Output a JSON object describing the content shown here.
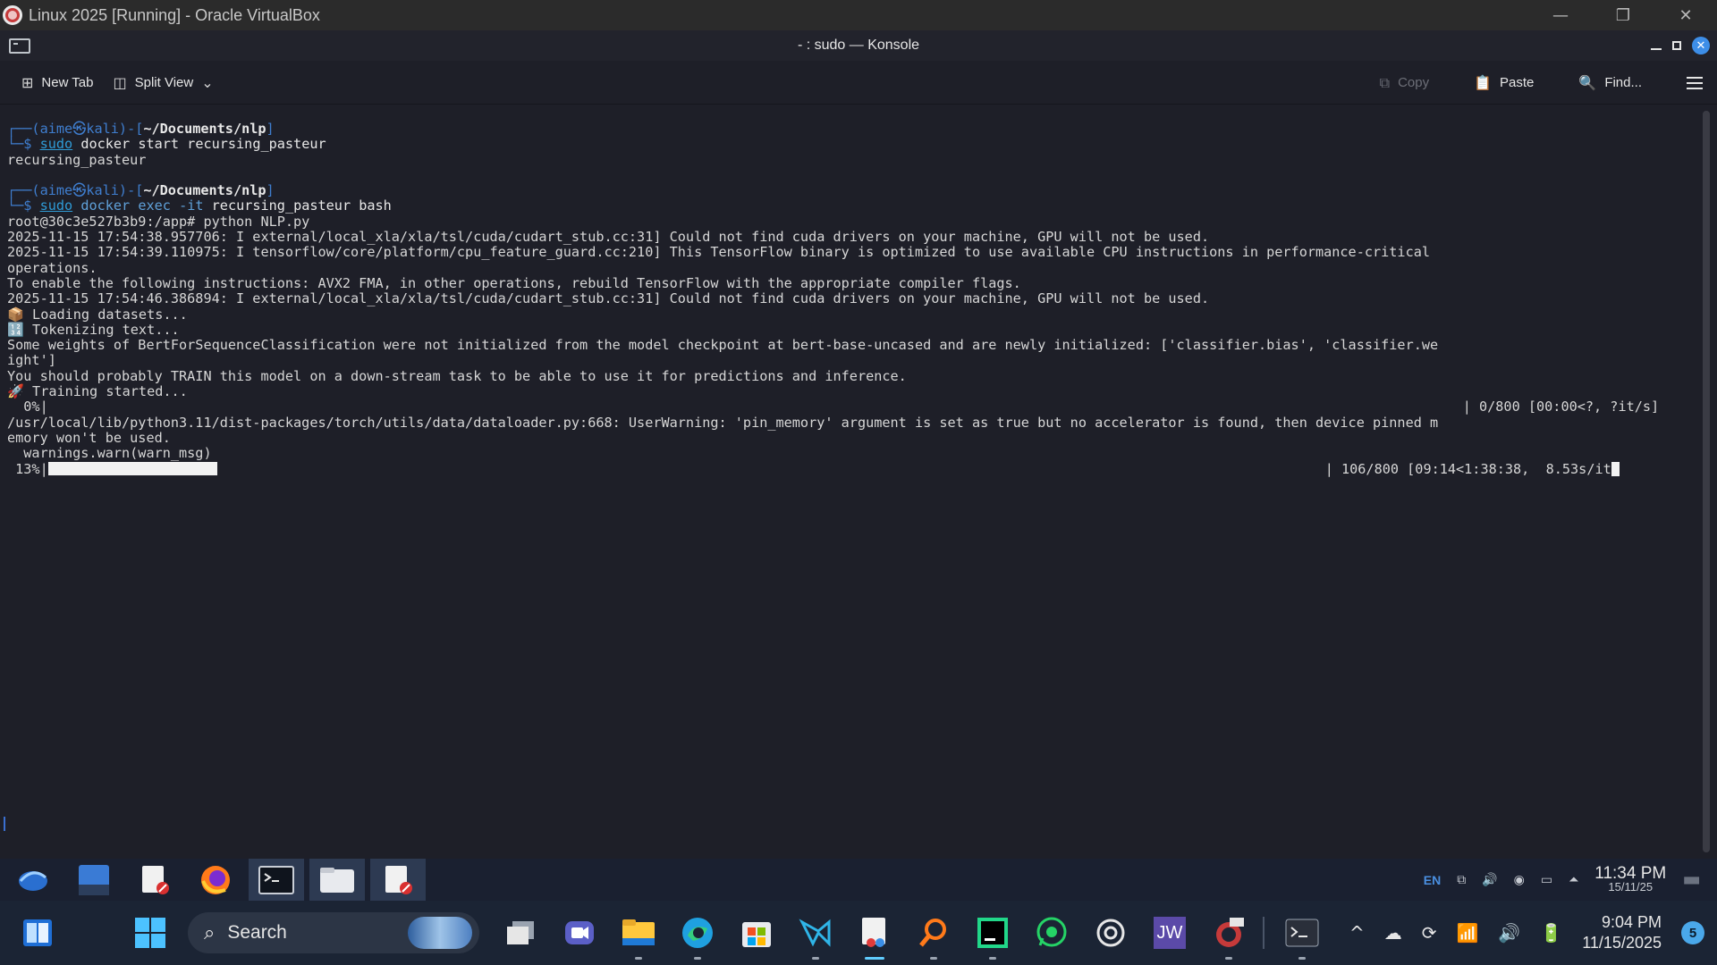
{
  "vbox": {
    "title": "Linux 2025 [Running] - Oracle VirtualBox",
    "minimize_icon": "minimize-icon",
    "restore_icon": "restore-icon",
    "close_icon": "close-icon"
  },
  "konsole": {
    "title": "- : sudo — Konsole",
    "toolbar": {
      "new_tab": "New Tab",
      "split_view": "Split View",
      "copy": "Copy",
      "paste": "Paste",
      "find": "Find..."
    },
    "terminal": {
      "prompt_user": "aime㉿kali",
      "prompt_path": "~/Documents/nlp",
      "cmd1_sudo": "sudo",
      "cmd1_rest": "docker start recursing_pasteur",
      "out1": "recursing_pasteur",
      "cmd2_sudo": "sudo",
      "cmd2_docker": "docker exec",
      "cmd2_flag": "-it",
      "cmd2_rest": "recursing_pasteur bash",
      "l_root": "root@30c3e527b3b9:/app# python NLP.py",
      "l1": "2025-11-15 17:54:38.957706: I external/local_xla/xla/tsl/cuda/cudart_stub.cc:31] Could not find cuda drivers on your machine, GPU will not be used.",
      "l2": "2025-11-15 17:54:39.110975: I tensorflow/core/platform/cpu_feature_guard.cc:210] This TensorFlow binary is optimized to use available CPU instructions in performance-critical",
      "l3": "operations.",
      "l4": "To enable the following instructions: AVX2 FMA, in other operations, rebuild TensorFlow with the appropriate compiler flags.",
      "l5": "2025-11-15 17:54:46.386894: I external/local_xla/xla/tsl/cuda/cudart_stub.cc:31] Could not find cuda drivers on your machine, GPU will not be used.",
      "l6": "📦 Loading datasets...",
      "l7": "🔢 Tokenizing text...",
      "l8": "Some weights of BertForSequenceClassification were not initialized from the model checkpoint at bert-base-uncased and are newly initialized: ['classifier.bias', 'classifier.we",
      "l9": "ight']",
      "l10": "You should probably TRAIN this model on a down-stream task to be able to use it for predictions and inference.",
      "l11": "🚀 Training started...",
      "l12a": "  0%|",
      "l12b": "| 0/800 [00:00<?, ?it/s]",
      "l13": "/usr/local/lib/python3.11/dist-packages/torch/utils/data/dataloader.py:668: UserWarning: 'pin_memory' argument is set as true but no accelerator is found, then device pinned m",
      "l14": "emory won't be used.",
      "l15": "  warnings.warn(warn_msg)",
      "l16a": " 13%|",
      "l16b": "| 106/800 [09:14<1:38:38,  8.53s/it",
      "progress": 0.1325
    }
  },
  "guest_taskbar": {
    "lang": "EN",
    "time": "11:34 PM",
    "date": "15/11/25"
  },
  "win_taskbar": {
    "search_label": "Search",
    "time": "9:04 PM",
    "date": "11/15/2025",
    "notification_count": "5",
    "jw_label": "JW"
  }
}
